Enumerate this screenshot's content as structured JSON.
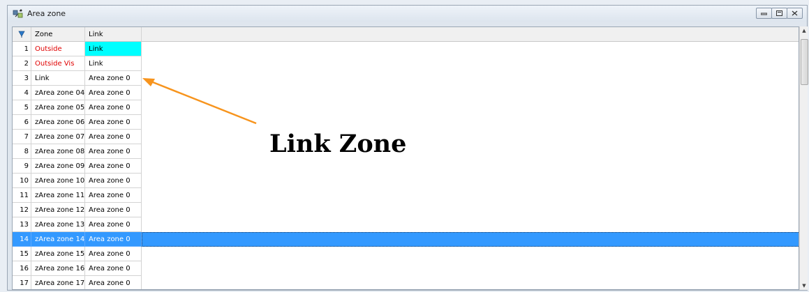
{
  "window": {
    "title": "Area zone",
    "controls": [
      "minimize",
      "restore",
      "close"
    ]
  },
  "grid": {
    "columns": [
      "Zone",
      "Link"
    ],
    "rows": [
      {
        "num": "1",
        "zone": "Outside",
        "link": "Link",
        "zone_color": "red",
        "link_highlight": true
      },
      {
        "num": "2",
        "zone": "Outside Vis",
        "link": "Link",
        "zone_color": "red"
      },
      {
        "num": "3",
        "zone": "Link",
        "link": "Area zone 0"
      },
      {
        "num": "4",
        "zone": "zArea zone 04",
        "link": "Area zone 0"
      },
      {
        "num": "5",
        "zone": "zArea zone 05",
        "link": "Area zone 0"
      },
      {
        "num": "6",
        "zone": "zArea zone 06",
        "link": "Area zone 0"
      },
      {
        "num": "7",
        "zone": "zArea zone 07",
        "link": "Area zone 0"
      },
      {
        "num": "8",
        "zone": "zArea zone 08",
        "link": "Area zone 0"
      },
      {
        "num": "9",
        "zone": "zArea zone 09",
        "link": "Area zone 0"
      },
      {
        "num": "10",
        "zone": "zArea zone 10",
        "link": "Area zone 0"
      },
      {
        "num": "11",
        "zone": "zArea zone 11",
        "link": "Area zone 0"
      },
      {
        "num": "12",
        "zone": "zArea zone 12",
        "link": "Area zone 0"
      },
      {
        "num": "13",
        "zone": "zArea zone 13",
        "link": "Area zone 0"
      },
      {
        "num": "14",
        "zone": "zArea zone 14",
        "link": "Area zone 0",
        "selected": true
      },
      {
        "num": "15",
        "zone": "zArea zone 15",
        "link": "Area zone 0"
      },
      {
        "num": "16",
        "zone": "zArea zone 16",
        "link": "Area zone 0"
      },
      {
        "num": "17",
        "zone": "zArea zone 17",
        "link": "Area zone 0"
      }
    ]
  },
  "annotation": {
    "text": "Link Zone",
    "arrow_color": "#f7941d"
  },
  "colors": {
    "selection": "#3399ff",
    "link_highlight": "#00ffff",
    "special_zone_text": "#e00000"
  }
}
